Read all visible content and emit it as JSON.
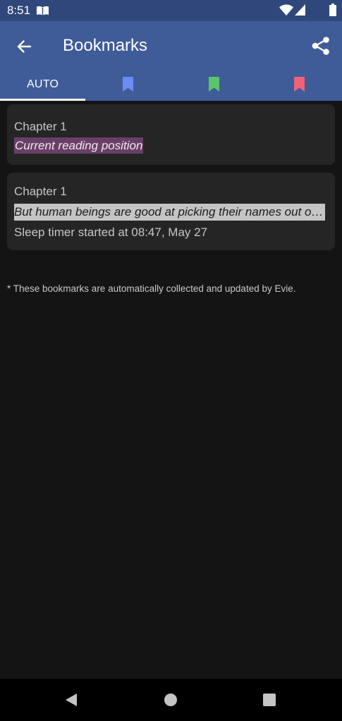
{
  "status_bar": {
    "time": "8:51",
    "icons": [
      "book-icon",
      "wifi-icon",
      "signal-icon",
      "battery-icon"
    ]
  },
  "app_bar": {
    "title": "Bookmarks",
    "back_icon": "arrow-left-icon",
    "share_icon": "share-icon"
  },
  "tabs": [
    {
      "label": "AUTO",
      "selected": true
    },
    {
      "icon": "bookmark-icon",
      "color": "#6b8cf5",
      "selected": false
    },
    {
      "icon": "bookmark-icon",
      "color": "#5cc46a",
      "selected": false
    },
    {
      "icon": "bookmark-icon",
      "color": "#f06277",
      "selected": false
    }
  ],
  "bookmarks": [
    {
      "chapter": "Chapter 1",
      "text": "Current reading position",
      "highlight_color": "#6a3f67"
    },
    {
      "chapter": "Chapter 1",
      "text": "But human beings are good at picking their names out of…",
      "highlight_color": "#c4c4c4",
      "note": "Sleep timer started at 08:47, May 27"
    }
  ],
  "footnote": "* These bookmarks are automatically collected and updated by Evie.",
  "colors": {
    "status_bar": "#30477b",
    "app_bar": "#3f5b98",
    "background": "#141414",
    "card": "#252525"
  },
  "nav_bar": {
    "icons": [
      "nav-back-icon",
      "nav-home-icon",
      "nav-recents-icon"
    ]
  }
}
